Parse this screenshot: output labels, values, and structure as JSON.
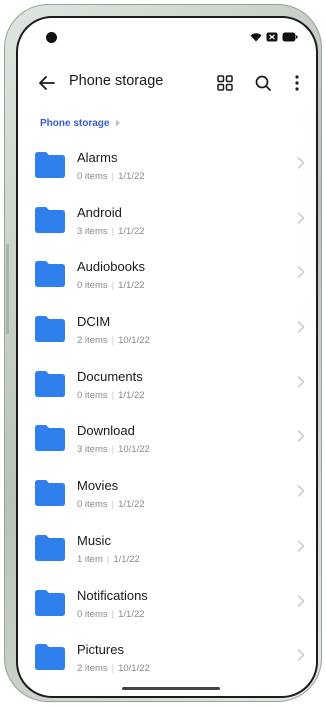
{
  "toolbar": {
    "title": "Phone storage"
  },
  "breadcrumb": {
    "label": "Phone storage"
  },
  "colors": {
    "accent": "#3b5bd6",
    "folder": "#2f80ed"
  },
  "folders": [
    {
      "name": "Alarms",
      "count": "0 items",
      "date": "1/1/22"
    },
    {
      "name": "Android",
      "count": "3 items",
      "date": "1/1/22"
    },
    {
      "name": "Audiobooks",
      "count": "0 items",
      "date": "1/1/22"
    },
    {
      "name": "DCIM",
      "count": "2 items",
      "date": "10/1/22"
    },
    {
      "name": "Documents",
      "count": "0 items",
      "date": "1/1/22"
    },
    {
      "name": "Download",
      "count": "3 items",
      "date": "10/1/22"
    },
    {
      "name": "Movies",
      "count": "0 items",
      "date": "1/1/22"
    },
    {
      "name": "Music",
      "count": "1 item",
      "date": "1/1/22"
    },
    {
      "name": "Notifications",
      "count": "0 items",
      "date": "1/1/22"
    },
    {
      "name": "Pictures",
      "count": "2 items",
      "date": "10/1/22"
    }
  ]
}
